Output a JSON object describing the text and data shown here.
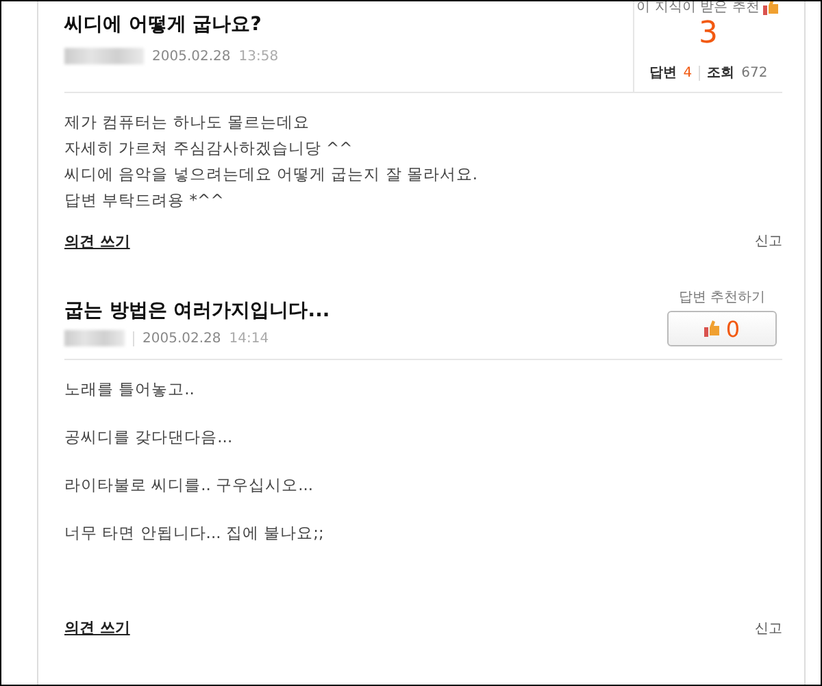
{
  "question": {
    "title": "씨디에 어떻게 굽나요?",
    "date": "2005.02.28",
    "time": "13:58",
    "recommend_label": "이 지식이 받은 추천",
    "recommend_count": "3",
    "answers_label": "답변",
    "answers_count": "4",
    "views_label": "조회",
    "views_count": "672",
    "body": [
      "제가 컴퓨터는 하나도 몰르는데요",
      "자세히 가르쳐 주심감사하겠습니당 ^^",
      "씨디에 음악을 넣으려는데요 어떻게 굽는지 잘 몰라서요.",
      "답변 부탁드려용 *^^"
    ],
    "comment_link": "의견 쓰기",
    "report_link": "신고"
  },
  "answer": {
    "title": "굽는 방법은 여러가지입니다...",
    "date": "2005.02.28",
    "time": "14:14",
    "recommend_label": "답변 추천하기",
    "recommend_count": "0",
    "body": [
      "노래를 틀어놓고..",
      "공씨디를 갖다댄다음...",
      "라이타불로 씨디를.. 구우십시오...",
      "너무 타면 안됩니다... 집에 불나요;;"
    ],
    "comment_link": "의견 쓰기",
    "report_link": "신고"
  }
}
